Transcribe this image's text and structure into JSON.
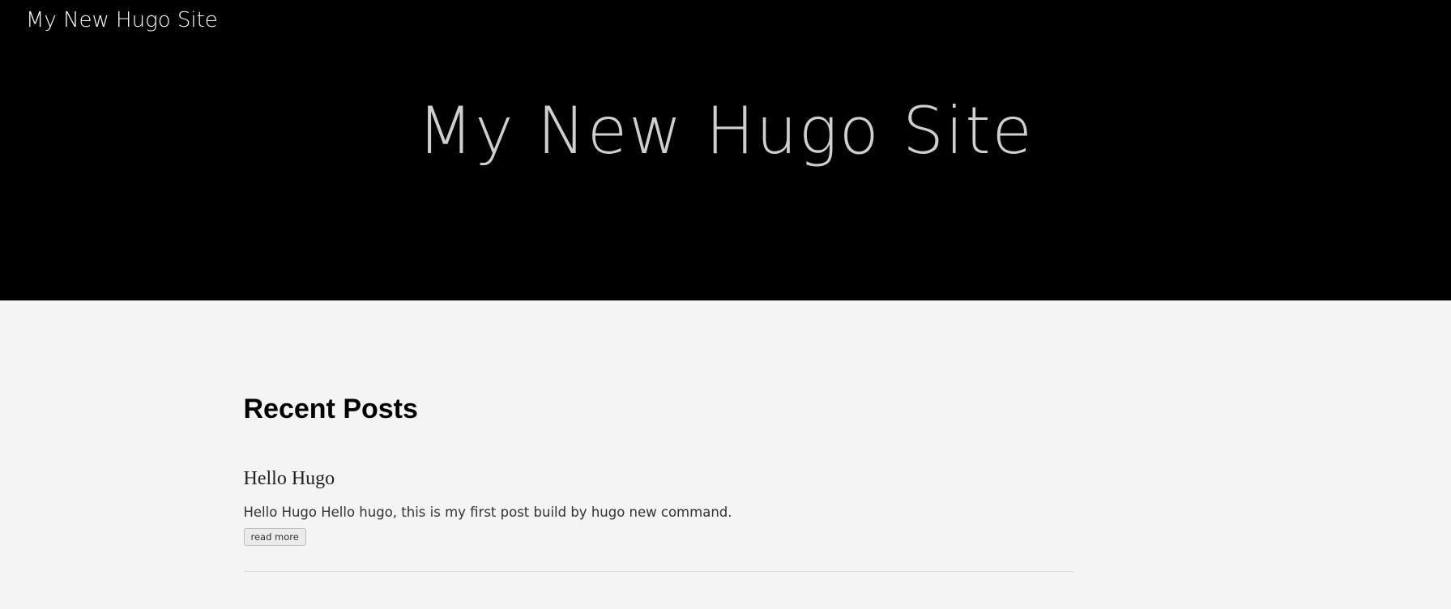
{
  "header": {
    "site_link": "My New Hugo Site",
    "hero_title": "My New Hugo Site"
  },
  "main": {
    "section_title": "Recent Posts",
    "posts": [
      {
        "title": "Hello Hugo",
        "summary": "Hello Hugo Hello hugo, this is my first post build by hugo new command.",
        "read_more_label": "read more"
      }
    ]
  },
  "colors": {
    "hero_background": "#000000",
    "page_background": "#f4f4f4"
  }
}
